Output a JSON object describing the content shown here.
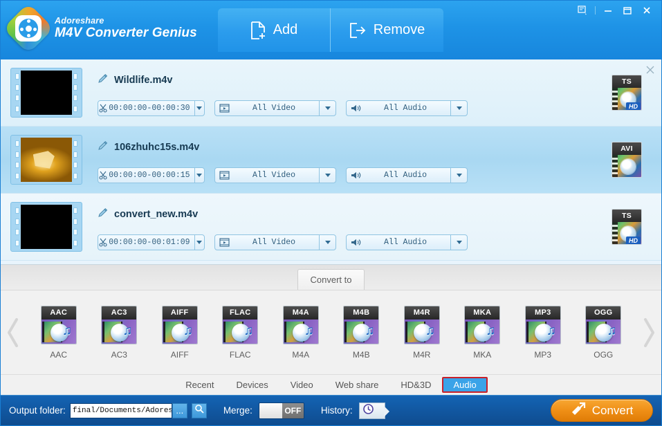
{
  "window": {
    "brand_top": "Adoreshare",
    "brand_main": "M4V Converter Genius",
    "controls": {
      "feedback": "feedback-icon",
      "minimize": "minimize-icon",
      "maximize": "maximize-icon",
      "close": "close-icon"
    }
  },
  "toolbar": {
    "add_label": "Add",
    "remove_label": "Remove"
  },
  "files": [
    {
      "name": "Wildlife.m4v",
      "trim": "00:00:00-00:00:30",
      "video": "All Video",
      "audio": "All Audio",
      "format": "TS",
      "hd": "HD",
      "thumb": "black",
      "selected": false
    },
    {
      "name": "106zhuhc15s.m4v",
      "trim": "00:00:00-00:00:15",
      "video": "All Video",
      "audio": "All Audio",
      "format": "AVI",
      "hd": "",
      "thumb": "gold",
      "selected": true
    },
    {
      "name": "convert_new.m4v",
      "trim": "00:00:00-00:01:09",
      "video": "All Video",
      "audio": "All Audio",
      "format": "TS",
      "hd": "HD",
      "thumb": "black",
      "selected": false
    }
  ],
  "convert_to": {
    "tab_label": "Convert to",
    "prev_arrow": "chevron-left-icon",
    "next_arrow": "chevron-right-icon",
    "formats": [
      {
        "cap": "AAC",
        "label": "AAC"
      },
      {
        "cap": "AC3",
        "label": "AC3"
      },
      {
        "cap": "AIFF",
        "label": "AIFF"
      },
      {
        "cap": "FLAC",
        "label": "FLAC"
      },
      {
        "cap": "M4A",
        "label": "M4A"
      },
      {
        "cap": "M4B",
        "label": "M4B"
      },
      {
        "cap": "M4R",
        "label": "M4R"
      },
      {
        "cap": "MKA",
        "label": "MKA"
      },
      {
        "cap": "MP3",
        "label": "MP3"
      },
      {
        "cap": "OGG",
        "label": "OGG"
      }
    ],
    "categories": [
      {
        "label": "Recent",
        "active": false
      },
      {
        "label": "Devices",
        "active": false
      },
      {
        "label": "Video",
        "active": false
      },
      {
        "label": "Web share",
        "active": false
      },
      {
        "label": "HD&3D",
        "active": false
      },
      {
        "label": "Audio",
        "active": true
      }
    ]
  },
  "bottom": {
    "output_label": "Output folder:",
    "output_path": "final/Documents/Adoreshare",
    "browse_label": "...",
    "search_icon": "search-icon",
    "merge_label": "Merge:",
    "merge_state": "OFF",
    "history_label": "History:",
    "history_icon": "clock-icon",
    "convert_label": "Convert"
  },
  "colors": {
    "titlebar": "#1e93e6",
    "bottombar": "#11569f",
    "accent_orange": "#ef8f16",
    "tab_active": "#3aa3e8",
    "highlight_border": "#c8202a",
    "row_selected": "#a9d8f2"
  }
}
